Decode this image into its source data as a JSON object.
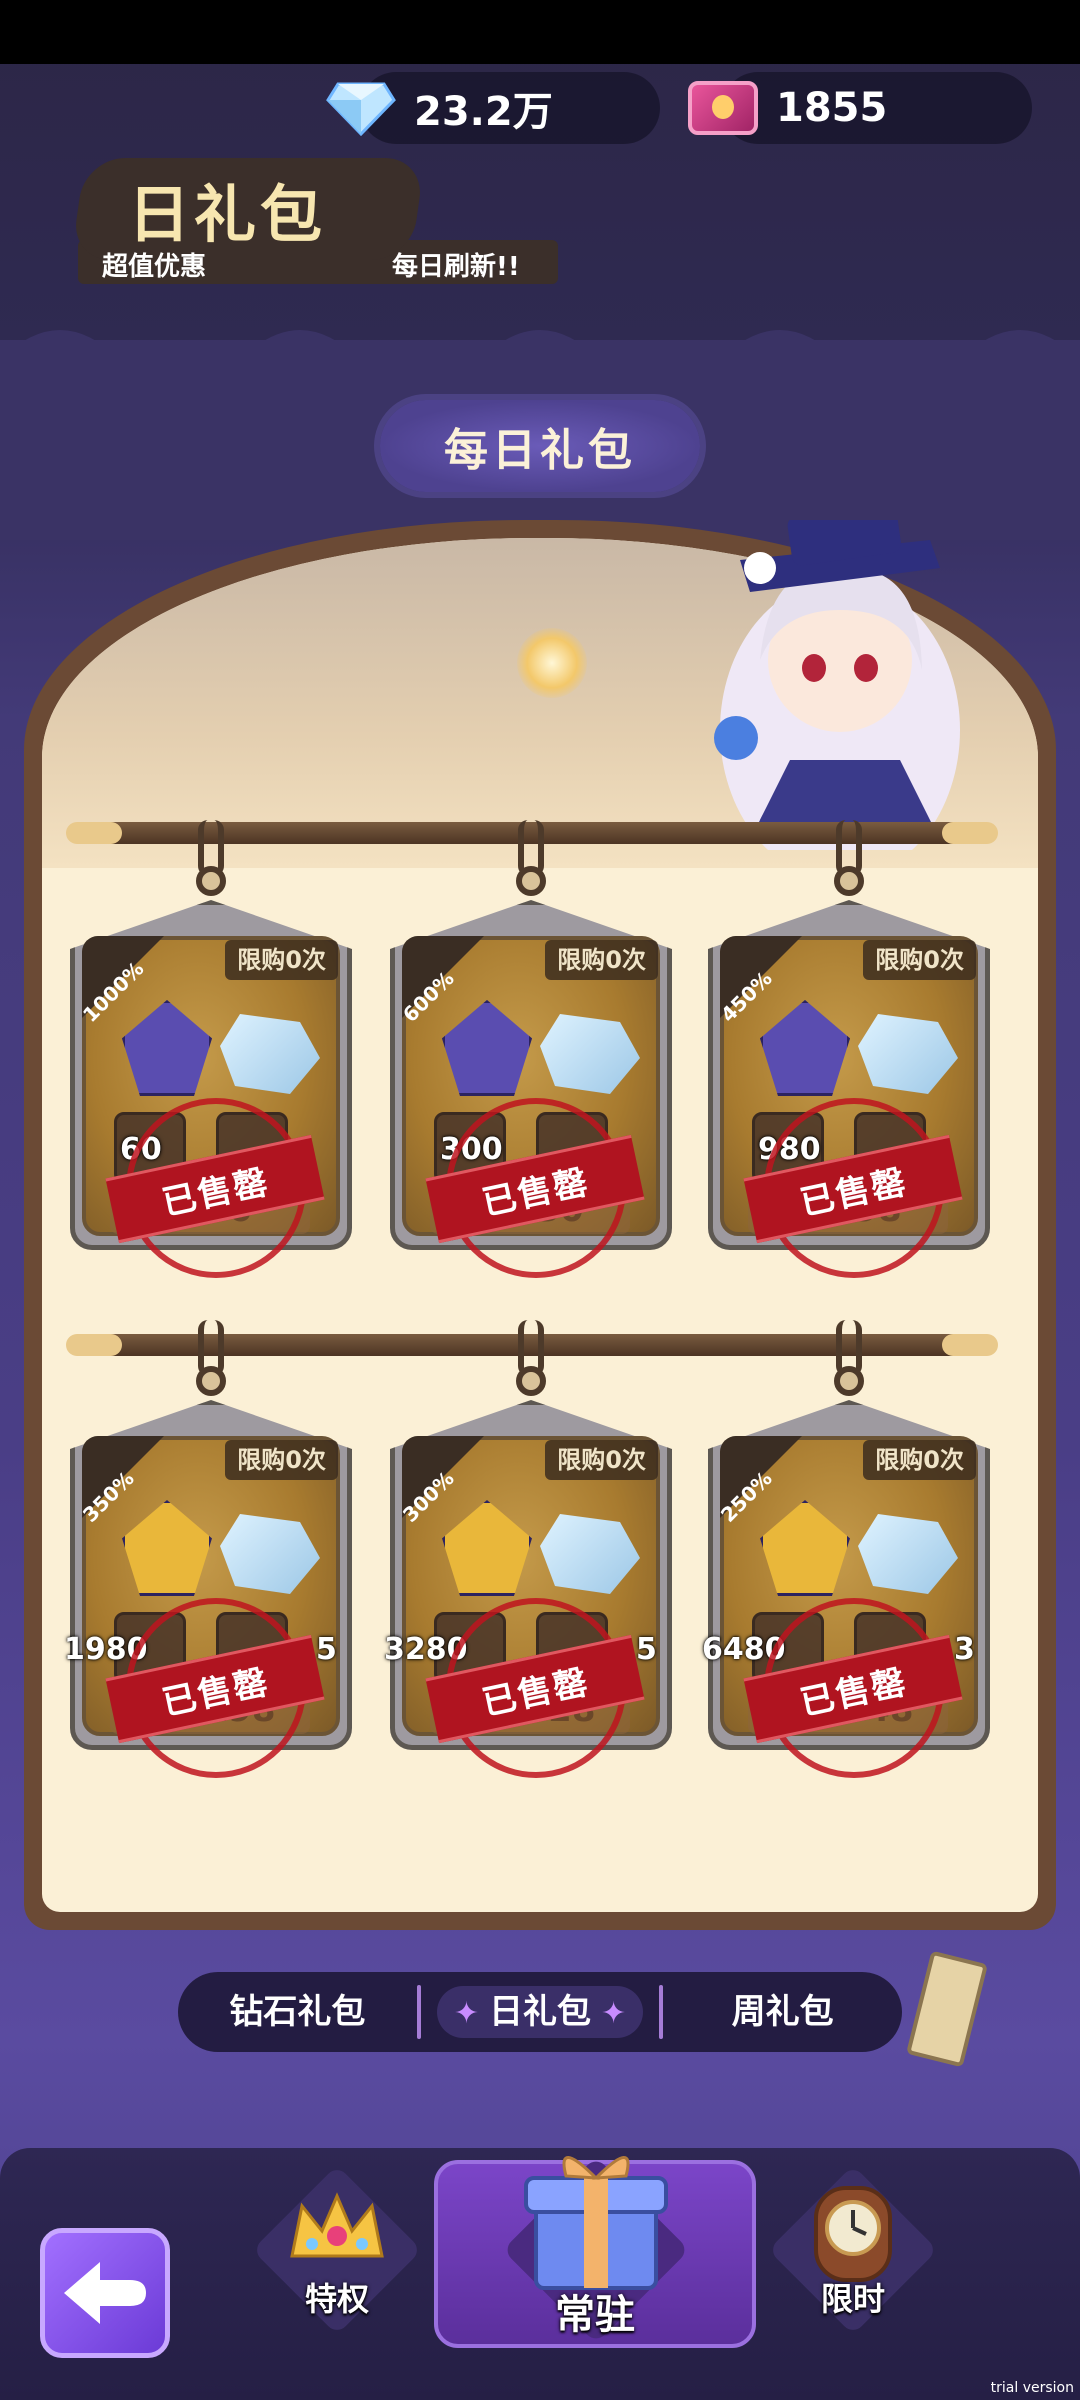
{
  "currency": {
    "diamonds": "23.2万",
    "tickets": "1855"
  },
  "header": {
    "title": "每日礼包"
  },
  "banner": {
    "title": "日礼包",
    "subtitle_left": "超值优惠",
    "subtitle_right": "每日刷新!!"
  },
  "packs": [
    {
      "percent": "1000%",
      "limit": "限购0次",
      "slot1": "60",
      "price": "6",
      "stamp": "已售罄"
    },
    {
      "percent": "600%",
      "limit": "限购0次",
      "slot1": "300",
      "price": "30",
      "stamp": "已售罄"
    },
    {
      "percent": "450%",
      "limit": "限购0次",
      "slot1": "980",
      "price": "98",
      "stamp": "已售罄"
    },
    {
      "percent": "350%",
      "limit": "限购0次",
      "slot1": "1980",
      "slot2": "5",
      "price": "198",
      "stamp": "已售罄"
    },
    {
      "percent": "300%",
      "limit": "限购0次",
      "slot1": "3280",
      "slot2": "5",
      "price": "328",
      "stamp": "已售罄"
    },
    {
      "percent": "250%",
      "limit": "限购0次",
      "slot1": "6480",
      "slot2": "3",
      "price": "648",
      "stamp": "已售罄"
    }
  ],
  "tabs": {
    "items": [
      "钻石礼包",
      "日礼包",
      "周礼包"
    ],
    "active": "日礼包"
  },
  "nav": {
    "privilege": "特权",
    "regular": "常驻",
    "limited": "限时"
  },
  "watermark": "trial version",
  "colors": {
    "accent_purple": "#7b45c8",
    "stamp_red": "#b01420",
    "banner_gold": "#f7e6b0"
  }
}
